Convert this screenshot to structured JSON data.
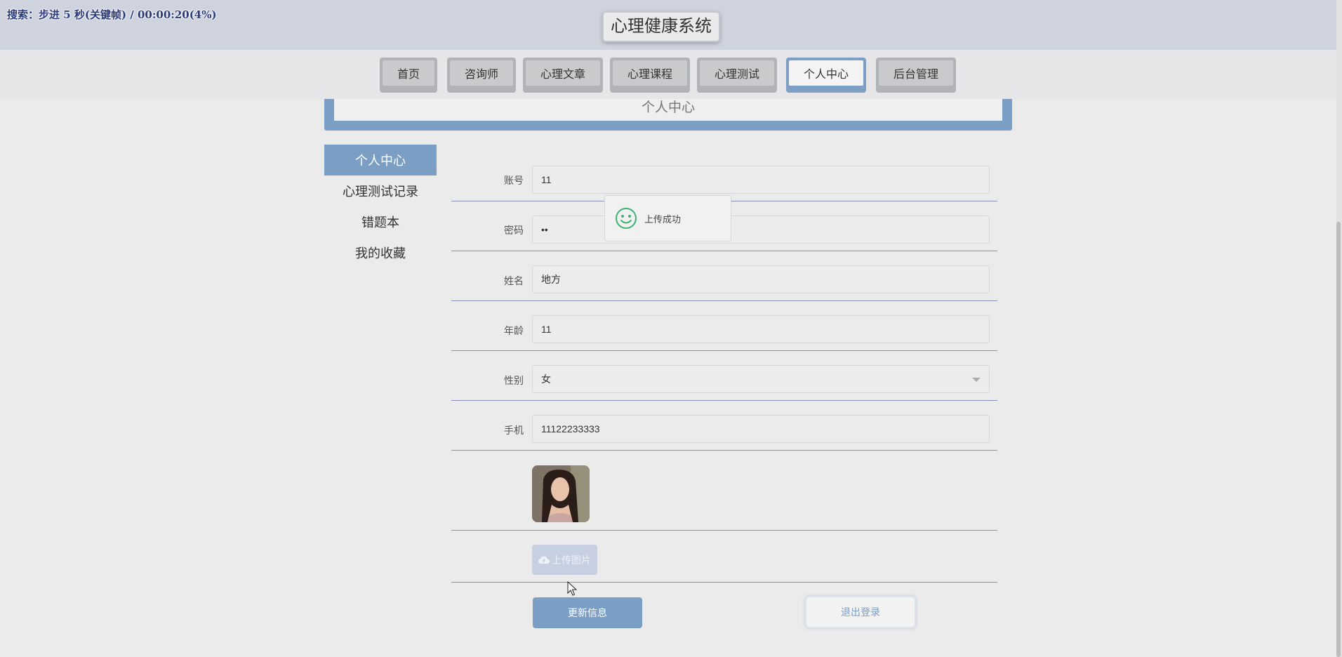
{
  "overlay": {
    "recording_text": "搜索：步进 5 秒(关键帧) / 00:00:20(4%)"
  },
  "site": {
    "title": "心理健康系统"
  },
  "nav": {
    "items": [
      {
        "label": "首页"
      },
      {
        "label": "咨询师"
      },
      {
        "label": "心理文章"
      },
      {
        "label": "心理课程"
      },
      {
        "label": "心理测试"
      },
      {
        "label": "个人中心",
        "active": true
      },
      {
        "label": "后台管理"
      }
    ]
  },
  "banner": {
    "title": "个人中心"
  },
  "sidebar": {
    "items": [
      {
        "label": "个人中心",
        "active": true
      },
      {
        "label": "心理测试记录"
      },
      {
        "label": "错题本"
      },
      {
        "label": "我的收藏"
      }
    ]
  },
  "form": {
    "account": {
      "label": "账号",
      "value": "11"
    },
    "password": {
      "label": "密码",
      "value": "••"
    },
    "name": {
      "label": "姓名",
      "value": "地方"
    },
    "age": {
      "label": "年龄",
      "value": "11"
    },
    "gender": {
      "label": "性别",
      "value": "女"
    },
    "phone": {
      "label": "手机",
      "value": "11122233333"
    },
    "upload_label": "上传图片",
    "update_label": "更新信息",
    "logout_label": "退出登录"
  },
  "toast": {
    "message": "上传成功"
  },
  "colors": {
    "accent": "#7b9ec4",
    "line": "#8d90b6",
    "success": "#3cb371"
  }
}
